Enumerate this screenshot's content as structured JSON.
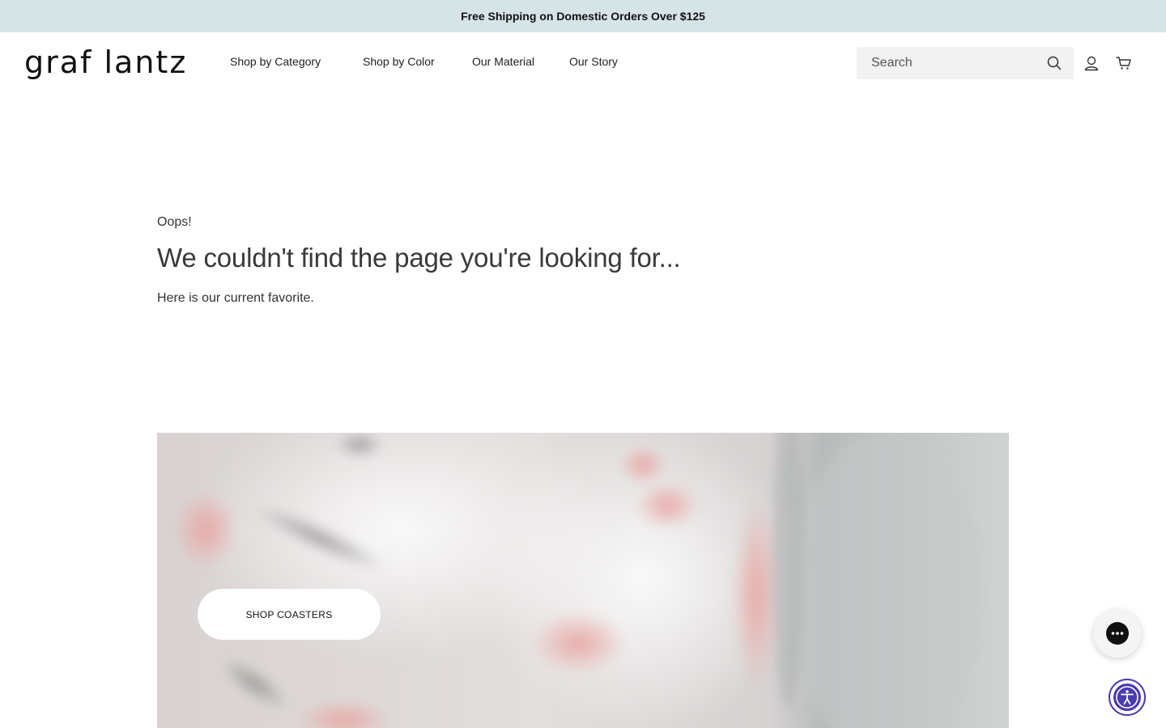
{
  "announcement": {
    "text": "Free Shipping on Domestic Orders Over $125"
  },
  "header": {
    "logo_text": "graf lantz",
    "nav": [
      {
        "label": "Shop by Category"
      },
      {
        "label": "Shop by Color"
      },
      {
        "label": "Our Material"
      },
      {
        "label": "Our Story"
      }
    ],
    "search": {
      "placeholder": "Search",
      "value": ""
    },
    "icons": {
      "search": "search-icon",
      "account": "user-icon",
      "cart": "cart-icon"
    }
  },
  "main": {
    "eyebrow": "Oops!",
    "headline": "We couldn't find the page you're looking for...",
    "subtext": "Here is our current favorite."
  },
  "hero": {
    "button_label": "SHOP COASTERS"
  },
  "widgets": {
    "chat_icon": "chat-bubble-icon",
    "accessibility_icon": "accessibility-icon"
  },
  "colors": {
    "announcement_bg": "#d6e4e8",
    "accessibility_ring": "#4b3bb0",
    "text": "#2b2b2b"
  }
}
